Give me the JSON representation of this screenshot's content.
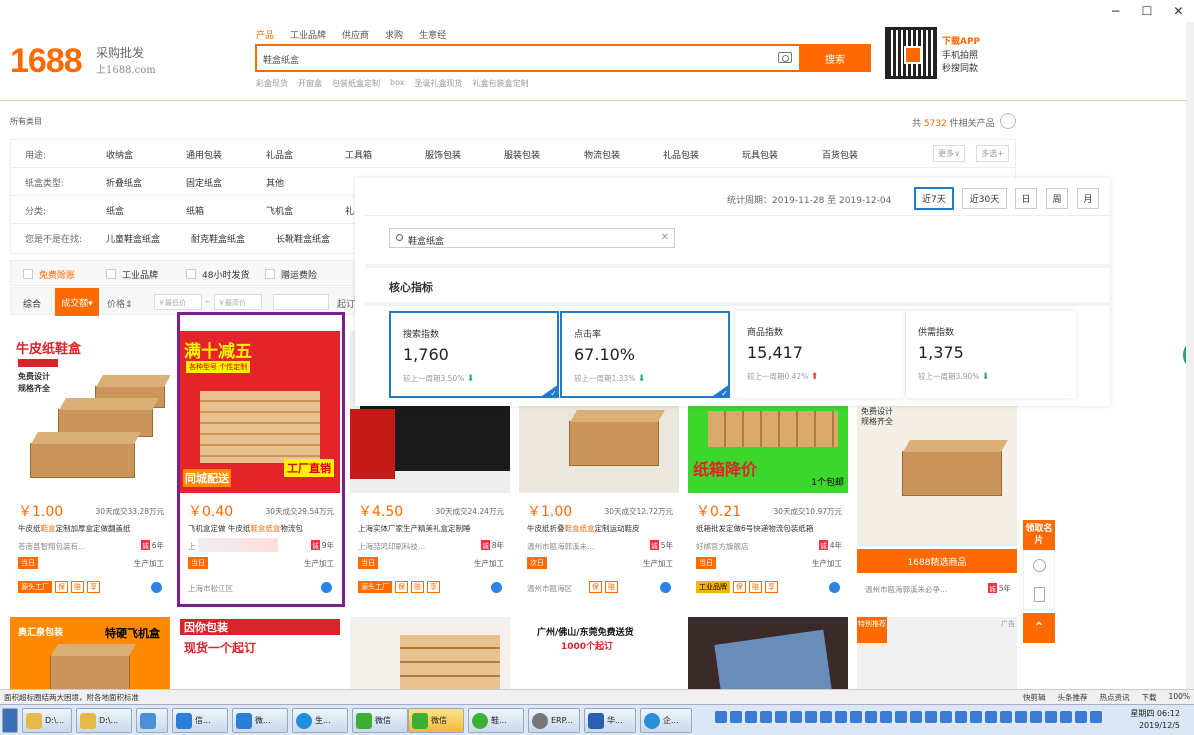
{
  "window": {
    "min": "−",
    "max": "☐",
    "close": "✕"
  },
  "logo": {
    "main": "1688",
    "sub1": "采购批发",
    "sub2": "上1688.com"
  },
  "search": {
    "tabs": [
      "产品",
      "工业品牌",
      "供应商",
      "求购",
      "生意经"
    ],
    "query": "鞋盒纸盒",
    "button": "搜索",
    "hot_words": [
      "彩盒现货",
      "开窗盒",
      "包装纸盒定制",
      "box",
      "圣诞礼盒现货",
      "礼盒包装盒定制"
    ]
  },
  "app": {
    "title": "下载APP",
    "line1": "手机拍照",
    "line2": "秒搜同款"
  },
  "category": {
    "all": "所有类目",
    "total_prefix": "共",
    "total_count": "5732",
    "total_suffix": "件相关产品"
  },
  "filters": {
    "rows": [
      {
        "label": "用途:",
        "options": [
          "收纳盒",
          "通用包装",
          "礼品盒",
          "工具箱",
          "服饰包装",
          "服装包装",
          "物流包装",
          "礼品包装",
          "玩具包装",
          "百货包装"
        ]
      },
      {
        "label": "纸盒类型:",
        "options": [
          "折叠纸盒",
          "固定纸盒",
          "其他"
        ]
      },
      {
        "label": "分类:",
        "options": [
          "纸盒",
          "纸箱",
          "飞机盒",
          "礼"
        ]
      },
      {
        "label": "您是不是在找:",
        "options": [
          "儿童鞋盒纸盒",
          "耐克鞋盒纸盒",
          "长靴鞋盒纸盒"
        ]
      }
    ],
    "more": "更多∨",
    "multi": "多选+"
  },
  "service": [
    "免费赊账",
    "工业品牌",
    "48小时发货",
    "赠运费险"
  ],
  "sort": {
    "items": [
      "综合",
      "成交额▾",
      "价格⇕"
    ],
    "price_low": "￥最低价",
    "price_high": "￥最高价",
    "dash": "–",
    "start": "起订"
  },
  "overlay": {
    "period_label": "统计周期：2019-11-28 至 2019-12-04",
    "periods": [
      "近7天",
      "近30天",
      "日",
      "周",
      "月"
    ],
    "keyword": "鞋盒纸盒",
    "core_title": "核心指标",
    "metrics": [
      {
        "title": "搜索指数",
        "value": "1,760",
        "change": "较上一周期3.50%",
        "dir": "down"
      },
      {
        "title": "点击率",
        "value": "67.10%",
        "change": "较上一周期1.33%",
        "dir": "down"
      },
      {
        "title": "商品指数",
        "value": "15,417",
        "change": "较上一周期0.42%",
        "dir": "up"
      },
      {
        "title": "供需指数",
        "value": "1,375",
        "change": "较上一周期3.90%",
        "dir": "down"
      }
    ]
  },
  "products": [
    {
      "img_title": "牛皮纸鞋盒",
      "img_lines": [
        "免费设计",
        "规格齐全"
      ],
      "price": "￥1.00",
      "sold": "30天成交33.28万元",
      "title_a": "牛皮纸",
      "title_hl": "鞋盒",
      "title_b": "定制加厚盒定做翻盖纸",
      "seller": "苍南县智翔包装有...",
      "years": "6年",
      "tag": "当日",
      "service": "生产加工",
      "tags": [
        "源头工厂",
        "保",
        "赔",
        "享"
      ]
    },
    {
      "img_title": "满十减五",
      "img_sub": "各种型号 个性定制",
      "img_bottom_left": "同城配送",
      "img_bottom_right": "工厂直销",
      "price": "￥0.40",
      "sold": "30天成交29.54万元",
      "title_a": "飞机盒定做 牛皮纸",
      "title_hl": "鞋盒纸盒",
      "title_b": "物流包",
      "seller": "上",
      "years": "9年",
      "tag": "当日",
      "service": "生产加工",
      "region": "上海市松江区"
    },
    {
      "price": "￥4.50",
      "sold": "30天成交24.24万元",
      "title_a": "上海实体厂家生产精美礼盒定制睡",
      "title_hl": "",
      "title_b": "",
      "seller": "上海喆鸿印刷科技...",
      "years": "8年",
      "tag": "当日",
      "service": "生产加工",
      "tags": [
        "源头工厂",
        "保",
        "赔",
        "享"
      ]
    },
    {
      "price": "￥1.00",
      "sold": "30天成交12.72万元",
      "title_a": "牛皮纸折叠",
      "title_hl": "鞋盒纸盒",
      "title_b": "定制运动鞋皮",
      "seller": "温州市瓯海郭溪未...",
      "years": "5年",
      "tag": "次日",
      "service": "生产加工",
      "region": "温州市瓯海区",
      "tags": [
        "保",
        "赔"
      ]
    },
    {
      "img_title": "纸箱降价",
      "img_sub": "1个包邮",
      "price": "￥0.21",
      "sold": "30天成交10.97万元",
      "title_a": "纸箱批发定做6号快递物流包装纸箱",
      "title_hl": "",
      "title_b": "",
      "seller": "好梆官方旗舰店",
      "years": "4年",
      "tag": "当日",
      "service": "生产加工",
      "tags": [
        "工业品牌",
        "保",
        "赔",
        "享"
      ]
    },
    {
      "img_lines": [
        "免费设计",
        "规格齐全"
      ],
      "btn": "1688精选商品",
      "seller": "温州市瓯海郭溪朱必争...",
      "years": "5年"
    }
  ],
  "row2": [
    {
      "brand": "奥汇泉包装",
      "title": "特硬飞机盒"
    },
    {
      "brand": "因你包装",
      "title": "现货一个起订"
    },
    {},
    {
      "line1": "广州/佛山/东莞免费送货",
      "line2": "1000个起订"
    },
    {},
    {
      "title": "特别推荐",
      "ad": "广告"
    }
  ],
  "sidebar": {
    "receive": "领取名片",
    "top": "⌃"
  },
  "statusbar": {
    "left": "面积超标圈结两大困境，附各地面积标准",
    "items": [
      "快剪辑",
      "头条推荐",
      "热点资讯",
      "下载",
      "100%"
    ]
  },
  "taskbar": {
    "items": [
      "D:\\...",
      "D:\\...",
      "",
      "信...",
      "微...",
      "生...",
      "微信",
      "微信",
      "鞋...",
      "ERP...",
      "华...",
      "企..."
    ],
    "clock_line1": "星期四 06:12",
    "clock_line2": "2019/12/5"
  },
  "colors": {
    "accent": "#ff6a00",
    "blue": "#1e7cc9",
    "purple": "#7a1f8f"
  }
}
